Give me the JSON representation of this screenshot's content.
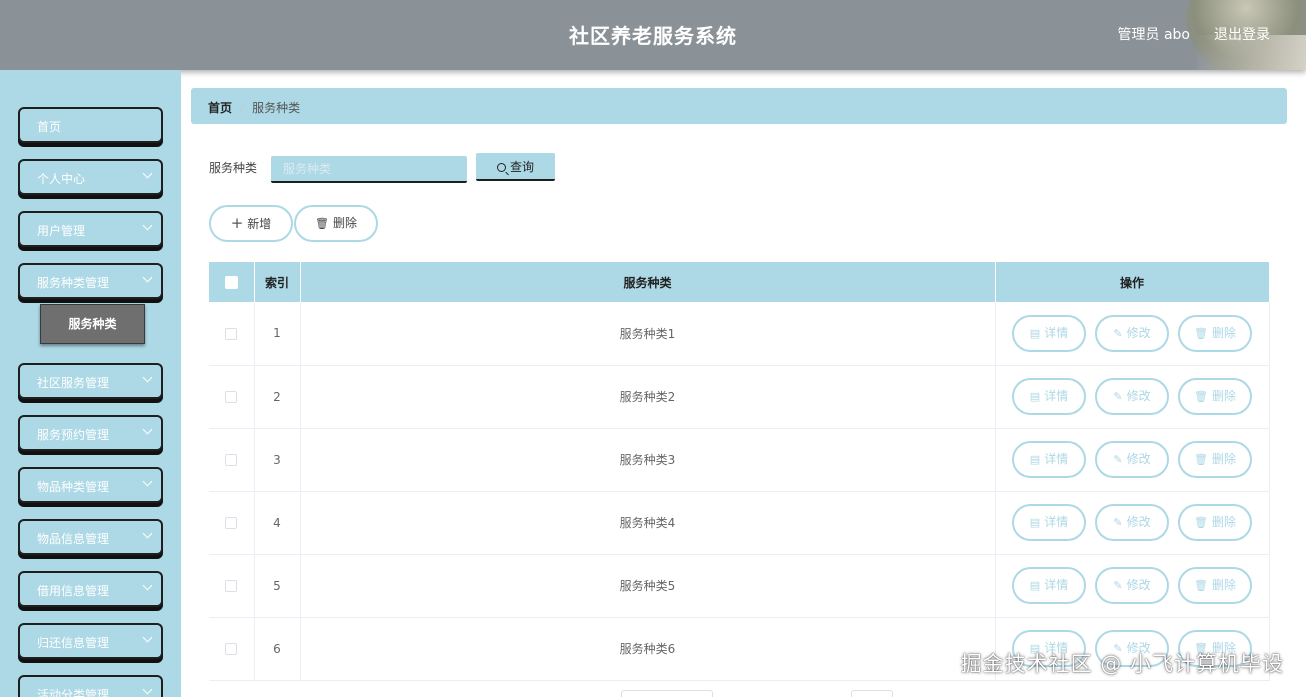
{
  "header": {
    "title": "社区养老服务系统",
    "user": "管理员 abo",
    "logout": "退出登录"
  },
  "sidebar": {
    "items": [
      {
        "label": "首页",
        "expandable": false
      },
      {
        "label": "个人中心",
        "expandable": true
      },
      {
        "label": "用户管理",
        "expandable": true
      },
      {
        "label": "服务种类管理",
        "expandable": true
      },
      {
        "label": "社区服务管理",
        "expandable": true
      },
      {
        "label": "服务预约管理",
        "expandable": true
      },
      {
        "label": "物品种类管理",
        "expandable": true
      },
      {
        "label": "物品信息管理",
        "expandable": true
      },
      {
        "label": "借用信息管理",
        "expandable": true
      },
      {
        "label": "归还信息管理",
        "expandable": true
      },
      {
        "label": "活动分类管理",
        "expandable": true
      }
    ],
    "active_sub": "服务种类"
  },
  "breadcrumb": {
    "home": "首页",
    "separator": "/",
    "current": "服务种类"
  },
  "search": {
    "label": "服务种类",
    "placeholder": "服务种类",
    "button": "查询"
  },
  "actions": {
    "add": "新增",
    "delete": "删除"
  },
  "table": {
    "columns": [
      "索引",
      "服务种类",
      "操作"
    ],
    "rows": [
      {
        "index": "1",
        "name": "服务种类1"
      },
      {
        "index": "2",
        "name": "服务种类2"
      },
      {
        "index": "3",
        "name": "服务种类3"
      },
      {
        "index": "4",
        "name": "服务种类4"
      },
      {
        "index": "5",
        "name": "服务种类5"
      },
      {
        "index": "6",
        "name": "服务种类6"
      }
    ],
    "row_actions": {
      "detail": "详情",
      "edit": "修改",
      "delete": "删除"
    }
  },
  "watermark": "掘金技术社区 @ 小飞计算机毕设",
  "colors": {
    "accent": "#add8e6",
    "header_bg": "#8a9298",
    "submenu_active": "#6f6f6f"
  }
}
